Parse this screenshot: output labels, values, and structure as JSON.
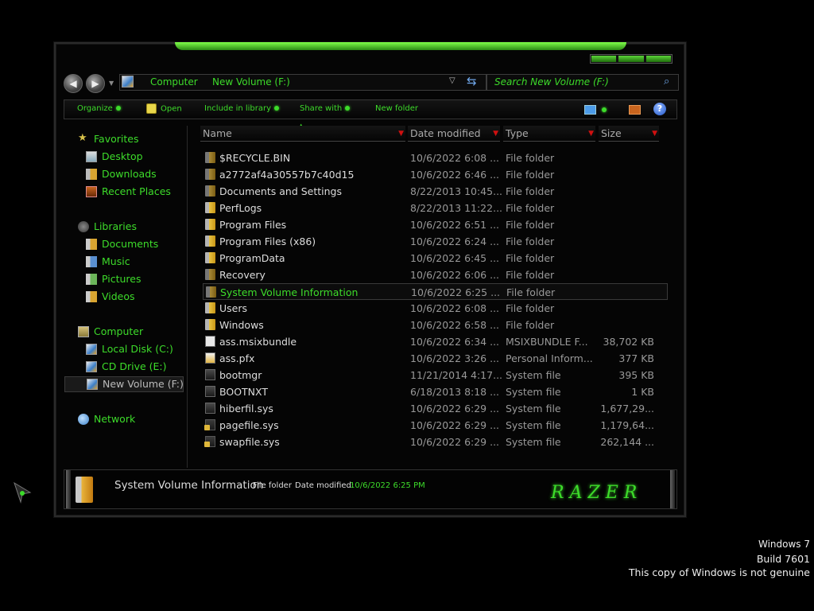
{
  "address": {
    "crumbs": [
      "Computer",
      "New Volume (F:)"
    ]
  },
  "search": {
    "placeholder": "Search New Volume (F:)"
  },
  "toolbar": {
    "organize": "Organize",
    "open": "Open",
    "include": "Include in library",
    "share": "Share with",
    "new_folder": "New folder"
  },
  "sidebar": {
    "favorites": "Favorites",
    "desktop": "Desktop",
    "downloads": "Downloads",
    "recent": "Recent Places",
    "libraries": "Libraries",
    "documents": "Documents",
    "music": "Music",
    "pictures": "Pictures",
    "videos": "Videos",
    "computer": "Computer",
    "local_disk": "Local Disk (C:)",
    "cd_drive": "CD Drive (E:)",
    "new_volume": "New Volume (F:)",
    "network": "Network"
  },
  "columns": {
    "name": "Name",
    "date": "Date modified",
    "type": "Type",
    "size": "Size"
  },
  "files": [
    {
      "name": "$RECYCLE.BIN",
      "date": "10/6/2022 6:08 ...",
      "type": "File folder",
      "size": "",
      "icon": "locked-folder-icon"
    },
    {
      "name": "a2772af4a30557b7c40d15",
      "date": "10/6/2022 6:46 ...",
      "type": "File folder",
      "size": "",
      "icon": "locked-folder-icon"
    },
    {
      "name": "Documents and Settings",
      "date": "8/22/2013 10:45...",
      "type": "File folder",
      "size": "",
      "icon": "locked-folder-icon"
    },
    {
      "name": "PerfLogs",
      "date": "8/22/2013 11:22...",
      "type": "File folder",
      "size": "",
      "icon": "folder-icon"
    },
    {
      "name": "Program Files",
      "date": "10/6/2022 6:51 ...",
      "type": "File folder",
      "size": "",
      "icon": "folder-icon"
    },
    {
      "name": "Program Files (x86)",
      "date": "10/6/2022 6:24 ...",
      "type": "File folder",
      "size": "",
      "icon": "folder-icon"
    },
    {
      "name": "ProgramData",
      "date": "10/6/2022 6:45 ...",
      "type": "File folder",
      "size": "",
      "icon": "folder-icon"
    },
    {
      "name": "Recovery",
      "date": "10/6/2022 6:06 ...",
      "type": "File folder",
      "size": "",
      "icon": "locked-folder-icon"
    },
    {
      "name": "System Volume Information",
      "date": "10/6/2022 6:25 ...",
      "type": "File folder",
      "size": "",
      "icon": "locked-folder-icon"
    },
    {
      "name": "Users",
      "date": "10/6/2022 6:08 ...",
      "type": "File folder",
      "size": "",
      "icon": "folder-icon"
    },
    {
      "name": "Windows",
      "date": "10/6/2022 6:58 ...",
      "type": "File folder",
      "size": "",
      "icon": "folder-icon"
    },
    {
      "name": "ass.msixbundle",
      "date": "10/6/2022 6:34 ...",
      "type": "MSIXBUNDLE F...",
      "size": "38,702 KB",
      "icon": "file-icon"
    },
    {
      "name": "ass.pfx",
      "date": "10/6/2022 3:26 ...",
      "type": "Personal Inform...",
      "size": "377 KB",
      "icon": "certificate-icon"
    },
    {
      "name": "bootmgr",
      "date": "11/21/2014 4:17...",
      "type": "System file",
      "size": "395 KB",
      "icon": "system-file-icon"
    },
    {
      "name": "BOOTNXT",
      "date": "6/18/2013 8:18 ...",
      "type": "System file",
      "size": "1 KB",
      "icon": "system-file-icon"
    },
    {
      "name": "hiberfil.sys",
      "date": "10/6/2022 6:29 ...",
      "type": "System file",
      "size": "1,677,29...",
      "icon": "system-file-icon"
    },
    {
      "name": "pagefile.sys",
      "date": "10/6/2022 6:29 ...",
      "type": "System file",
      "size": "1,179,64...",
      "icon": "locked-system-file-icon"
    },
    {
      "name": "swapfile.sys",
      "date": "10/6/2022 6:29 ...",
      "type": "System file",
      "size": "262,144 ...",
      "icon": "locked-system-file-icon"
    }
  ],
  "selected_index": 8,
  "details": {
    "name": "System Volume Information",
    "type": "File folder",
    "date_label": "Date modified:",
    "date_value": "10/6/2022 6:25 PM",
    "logo_text": "RAZER"
  },
  "watermark": {
    "line1": "Windows 7",
    "line2": "Build 7601",
    "line3": "This copy of Windows is not genuine"
  },
  "colors": {
    "accent": "#3ddc2a",
    "background": "#000000",
    "sort_arrow": "#d01010"
  }
}
